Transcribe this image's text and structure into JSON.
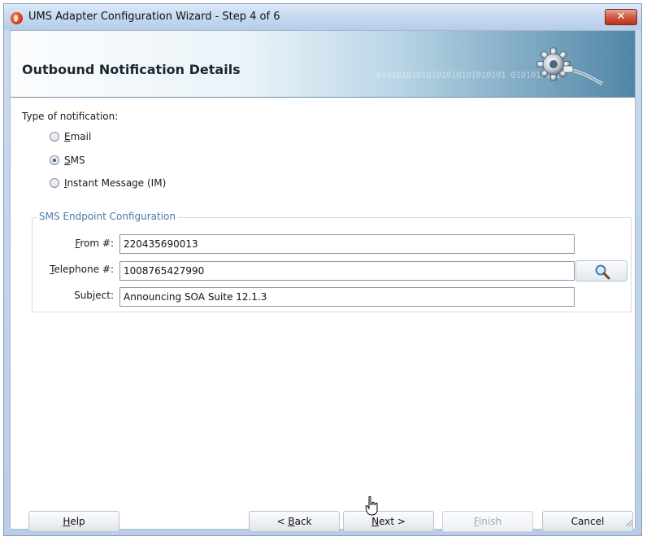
{
  "window": {
    "title": "UMS Adapter Configuration Wizard - Step 4 of 6",
    "close_label": "✕"
  },
  "header": {
    "title": "Outbound Notification Details",
    "binary_decoration": "01010101010101010101010101 0101010101"
  },
  "notification": {
    "label": "Type of notification:",
    "options": [
      {
        "label_first": "E",
        "label_rest": "mail",
        "checked": false
      },
      {
        "label_first": "S",
        "label_rest": "MS",
        "checked": true
      },
      {
        "label_first": "I",
        "label_rest": "nstant Message (IM)",
        "checked": false
      }
    ]
  },
  "sms_config": {
    "legend": "SMS Endpoint Configuration",
    "from": {
      "label_first": "F",
      "label_rest": "rom #:",
      "value": "220435690013"
    },
    "telephone": {
      "label_first": "T",
      "label_rest": "elephone #:",
      "value": "1008765427990"
    },
    "subject": {
      "label_pre": "Sub",
      "label_u": "j",
      "label_post": "ect:",
      "value": "Announcing SOA Suite 12.1.3"
    }
  },
  "buttons": {
    "help": {
      "u": "H",
      "rest": "elp"
    },
    "back": {
      "pre": "< ",
      "u": "B",
      "rest": "ack"
    },
    "next": {
      "u": "N",
      "rest": "ext >"
    },
    "finish": {
      "u": "F",
      "rest": "inish"
    },
    "cancel": "Cancel"
  },
  "colors": {
    "accent": "#4a78a8",
    "banner_dark": "#4f86a6",
    "close_red": "#cf5a45"
  }
}
